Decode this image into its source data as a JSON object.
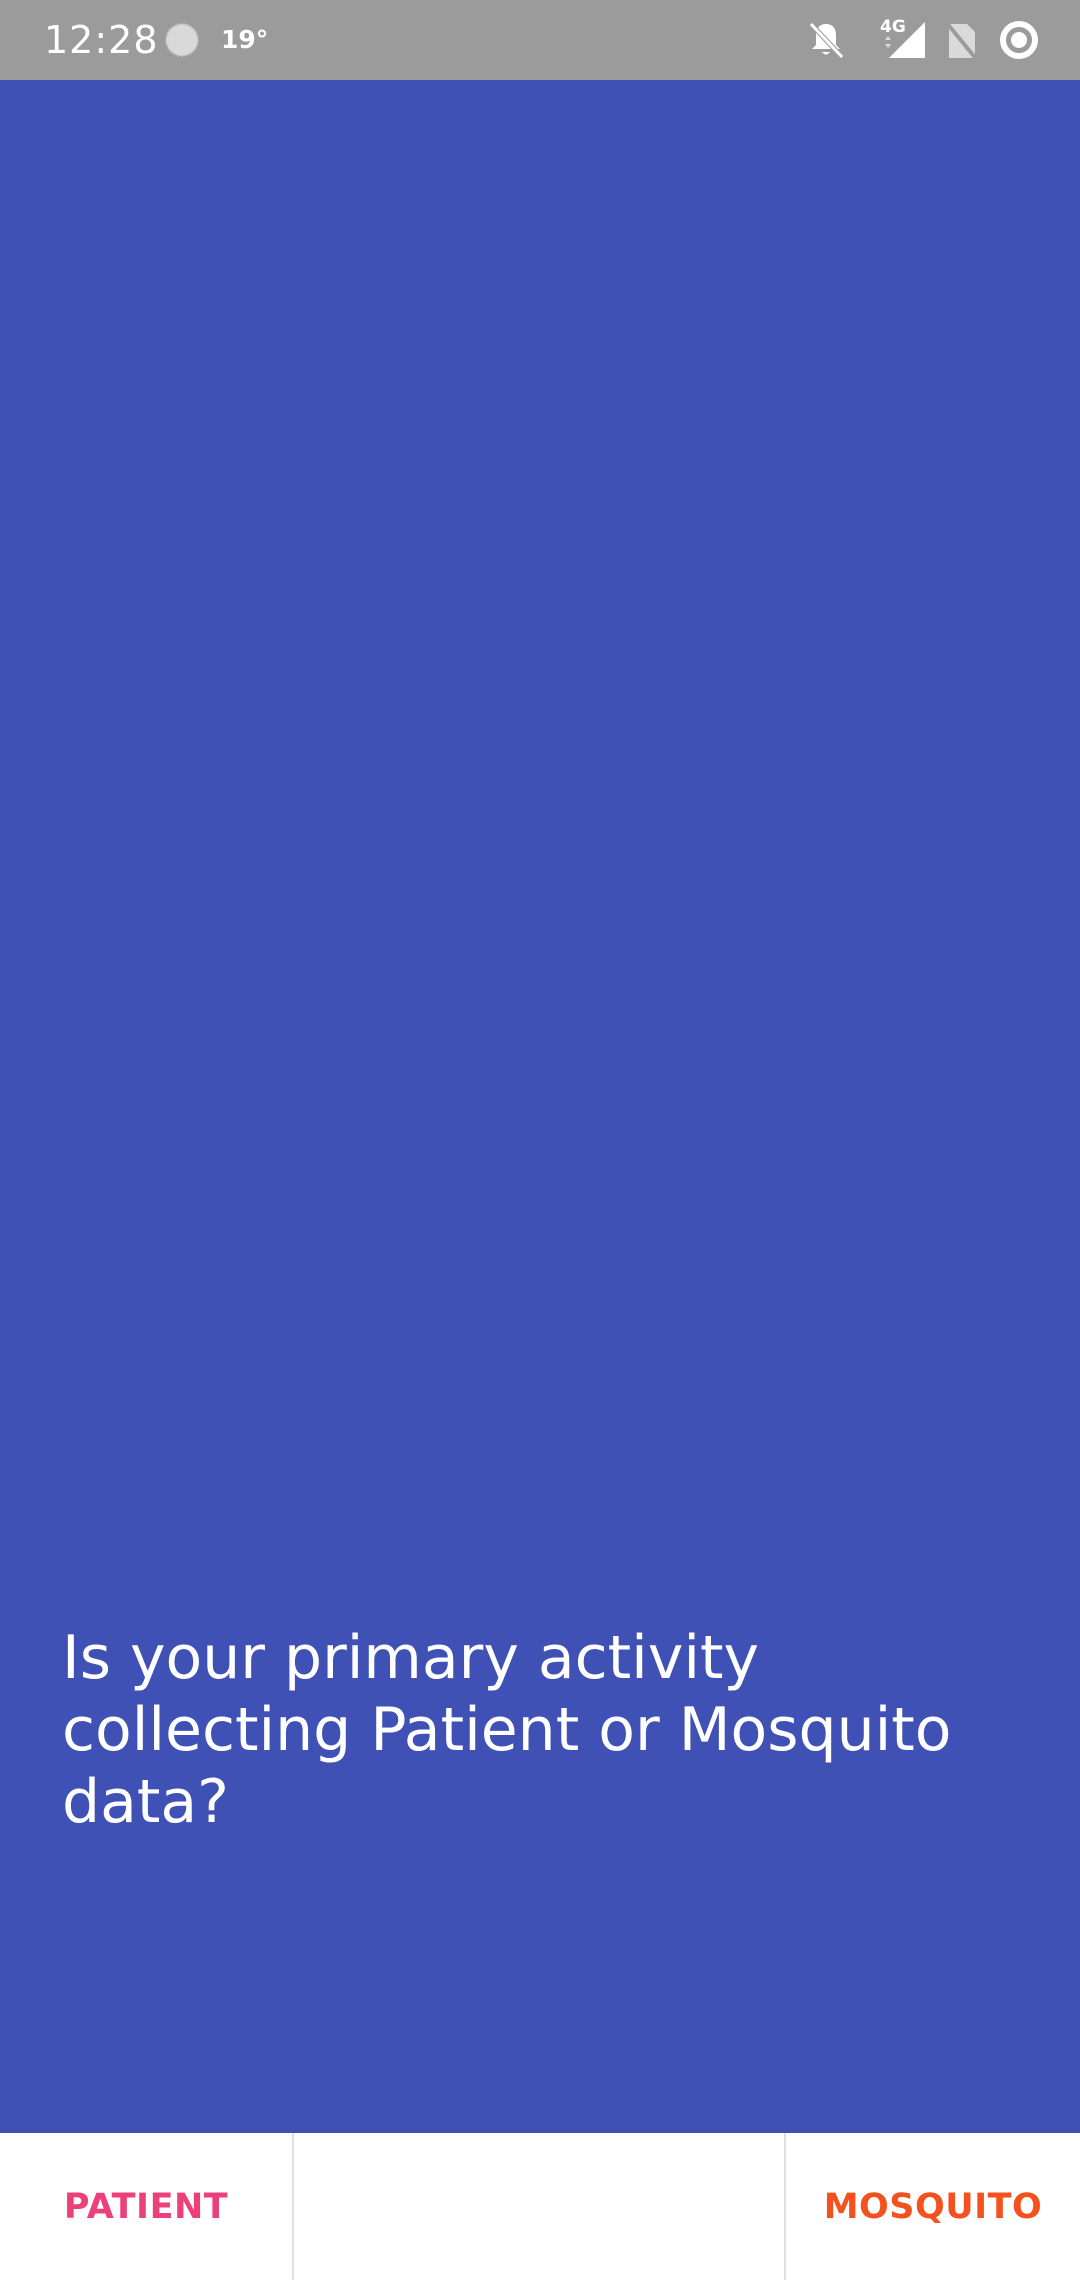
{
  "status_bar": {
    "time": "12:28",
    "temperature": "19°",
    "network_type": "4G",
    "icons": [
      "weather-icon",
      "mute-notifications-icon",
      "cellular-signal-icon",
      "no-sim-icon",
      "ring-status-icon"
    ]
  },
  "main": {
    "background_color": "#3f51b5",
    "question": "Is your primary activity collecting Patient or Mosquito data?"
  },
  "bottom_bar": {
    "patient_label": "PATIENT",
    "patient_color": "#ec407a",
    "mosquito_label": "MOSQUITO",
    "mosquito_color": "#f4511e"
  }
}
